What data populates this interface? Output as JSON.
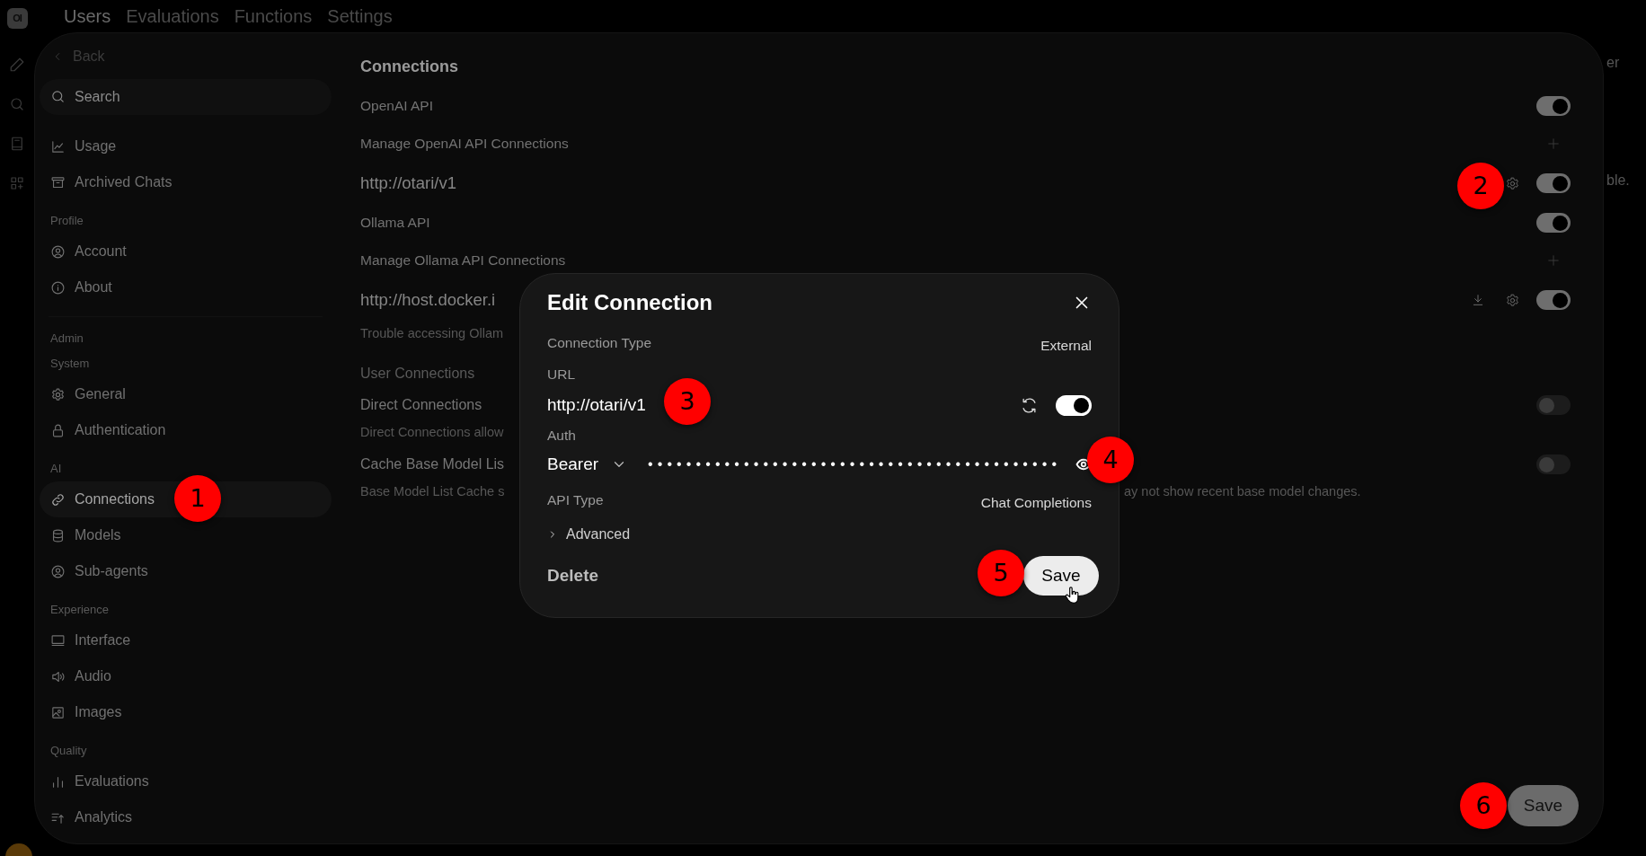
{
  "logo": {
    "text": "OI"
  },
  "nav_tabs": [
    {
      "label": "Users",
      "selected": true
    },
    {
      "label": "Evaluations",
      "selected": false
    },
    {
      "label": "Functions",
      "selected": false
    },
    {
      "label": "Settings",
      "selected": false
    }
  ],
  "background_fragments": [
    {
      "text": "er"
    },
    {
      "text": "ble."
    }
  ],
  "settings": {
    "back": "Back",
    "search": {
      "placeholder": "Search"
    },
    "sidebar": [
      {
        "kind": "plain",
        "items": [
          {
            "label": "Usage",
            "selected": false
          },
          {
            "label": "Archived Chats",
            "selected": false
          }
        ]
      },
      {
        "kind": "section",
        "title": "Profile",
        "items": [
          {
            "label": "Account",
            "selected": false
          },
          {
            "label": "About",
            "selected": false
          }
        ]
      },
      {
        "kind": "group",
        "title": "Admin"
      },
      {
        "kind": "section",
        "title": "System",
        "items": [
          {
            "label": "General",
            "selected": false
          },
          {
            "label": "Authentication",
            "selected": false
          }
        ]
      },
      {
        "kind": "section",
        "title": "AI",
        "items": [
          {
            "label": "Connections",
            "selected": true
          },
          {
            "label": "Models",
            "selected": false
          },
          {
            "label": "Sub-agents",
            "selected": false
          }
        ]
      },
      {
        "kind": "section",
        "title": "Experience",
        "items": [
          {
            "label": "Interface",
            "selected": false
          },
          {
            "label": "Audio",
            "selected": false
          },
          {
            "label": "Images",
            "selected": false
          }
        ]
      },
      {
        "kind": "section",
        "title": "Quality",
        "items": [
          {
            "label": "Evaluations",
            "selected": false
          },
          {
            "label": "Analytics",
            "selected": false
          }
        ]
      }
    ],
    "main": {
      "groups": [
        {
          "kind": "page",
          "title": "Connections",
          "rows": [
            {
              "kind": "switch",
              "label": "OpenAI API",
              "on": true
            },
            {
              "kind": "add",
              "label": "Manage OpenAI API Connections"
            },
            {
              "kind": "connection",
              "label": "http://otari/v1",
              "on": true
            },
            {
              "kind": "switch",
              "label": "Ollama API",
              "on": true
            },
            {
              "kind": "add",
              "label": "Manage Ollama API Connections"
            },
            {
              "kind": "ollama",
              "label": "http://host.docker.i",
              "on": true
            },
            {
              "kind": "note",
              "label": "Trouble accessing Ollam"
            }
          ]
        },
        {
          "kind": "subsection",
          "title": "User Connections",
          "rows": [
            {
              "kind": "switch",
              "label": "Direct Connections",
              "on": false
            },
            {
              "kind": "note",
              "label": "Direct Connections allow"
            },
            {
              "kind": "switch",
              "label": "Cache Base Model Lis",
              "on": false
            },
            {
              "kind": "note",
              "label": "Base Model List Cache s",
              "continued": "ay not show recent base model changes."
            }
          ]
        }
      ]
    },
    "save": "Save"
  },
  "modal": {
    "title": "Edit Connection",
    "connection_type": {
      "label": "Connection Type",
      "value": "External"
    },
    "url": {
      "label": "URL",
      "value": "http://otari/v1",
      "enabled": true
    },
    "auth": {
      "label": "Auth",
      "type": "Bearer",
      "key": "•••••••••••••••••••••••••••••••••••••••••••"
    },
    "api_type": {
      "label": "API Type",
      "value": "Chat Completions"
    },
    "advanced": {
      "label": "Advanced",
      "expanded": false
    },
    "delete": "Delete",
    "save": "Save"
  },
  "annotations": [
    {
      "label": "1"
    },
    {
      "label": "2"
    },
    {
      "label": "3"
    },
    {
      "label": "4"
    },
    {
      "label": "5"
    },
    {
      "label": "6"
    }
  ]
}
